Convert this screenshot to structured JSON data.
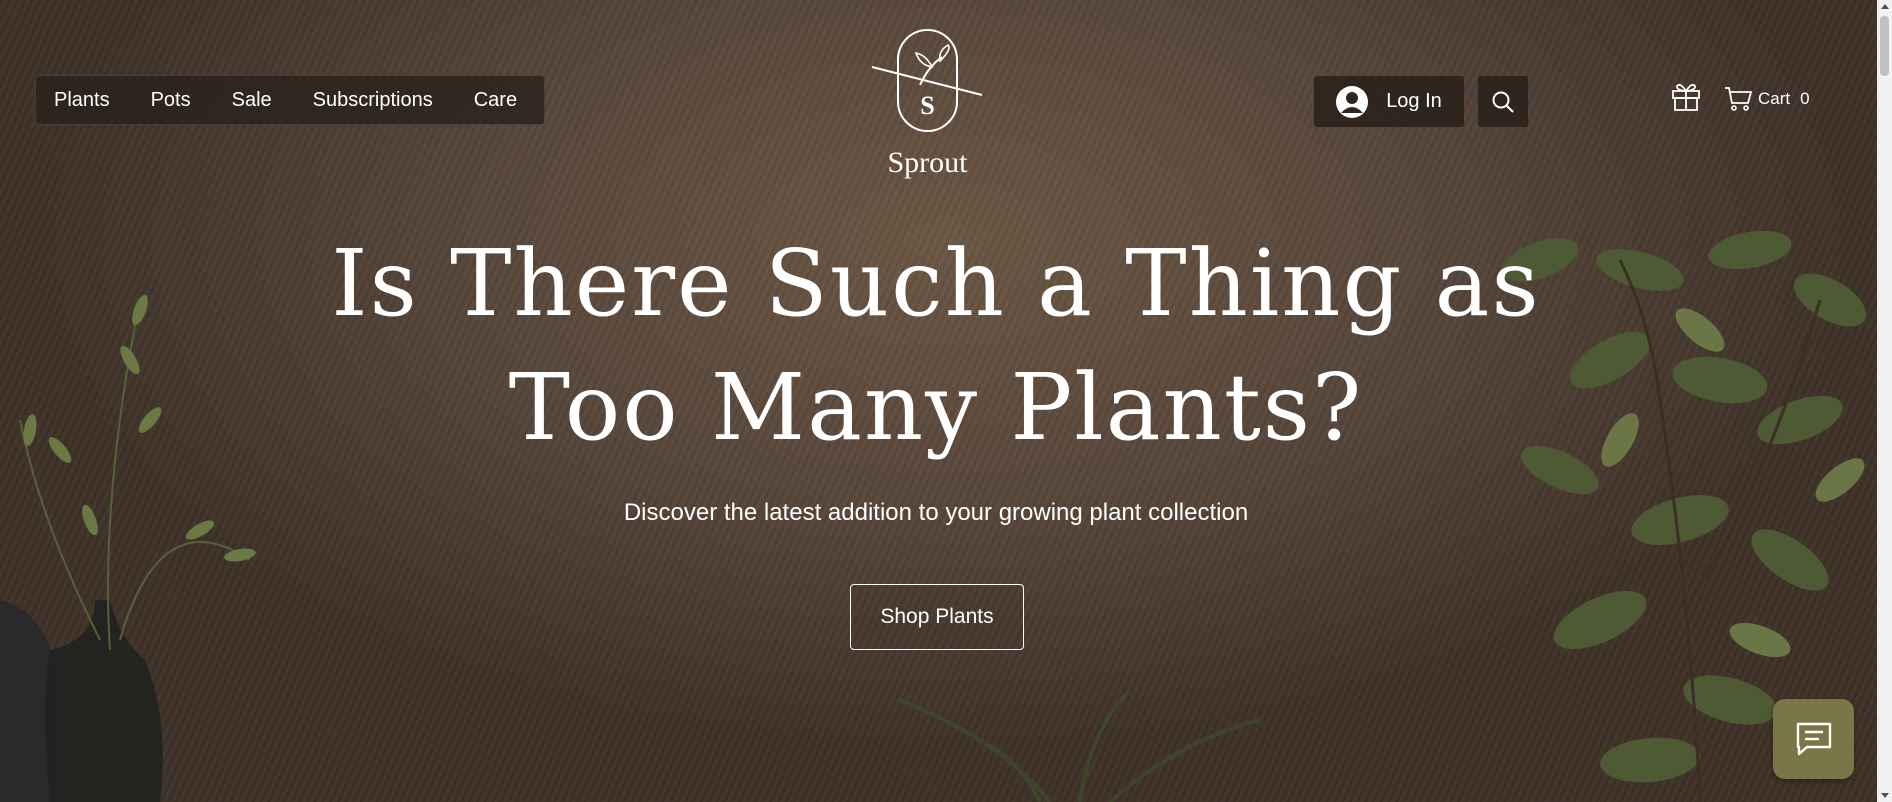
{
  "nav": {
    "items": [
      {
        "label": "Plants"
      },
      {
        "label": "Pots"
      },
      {
        "label": "Sale"
      },
      {
        "label": "Subscriptions"
      },
      {
        "label": "Care"
      }
    ]
  },
  "logo": {
    "initial": "S",
    "wordmark": "Sprout"
  },
  "header": {
    "login_label": "Log In",
    "login_icon": "user-avatar-icon",
    "search_icon": "search-icon",
    "gift_icon": "gift-icon",
    "cart_icon": "cart-icon",
    "cart_label": "Cart",
    "cart_count": "0"
  },
  "hero": {
    "headline_line1": "Is There Such a Thing as",
    "headline_line2": "Too Many Plants?",
    "subheadline": "Discover the latest addition to your growing plant collection",
    "cta_label": "Shop Plants"
  },
  "chat": {
    "icon": "chat-icon"
  },
  "colors": {
    "background": "#5a4838",
    "nav_bg": "#28201a",
    "chat_button": "#7a7648",
    "text": "#ffffff"
  }
}
